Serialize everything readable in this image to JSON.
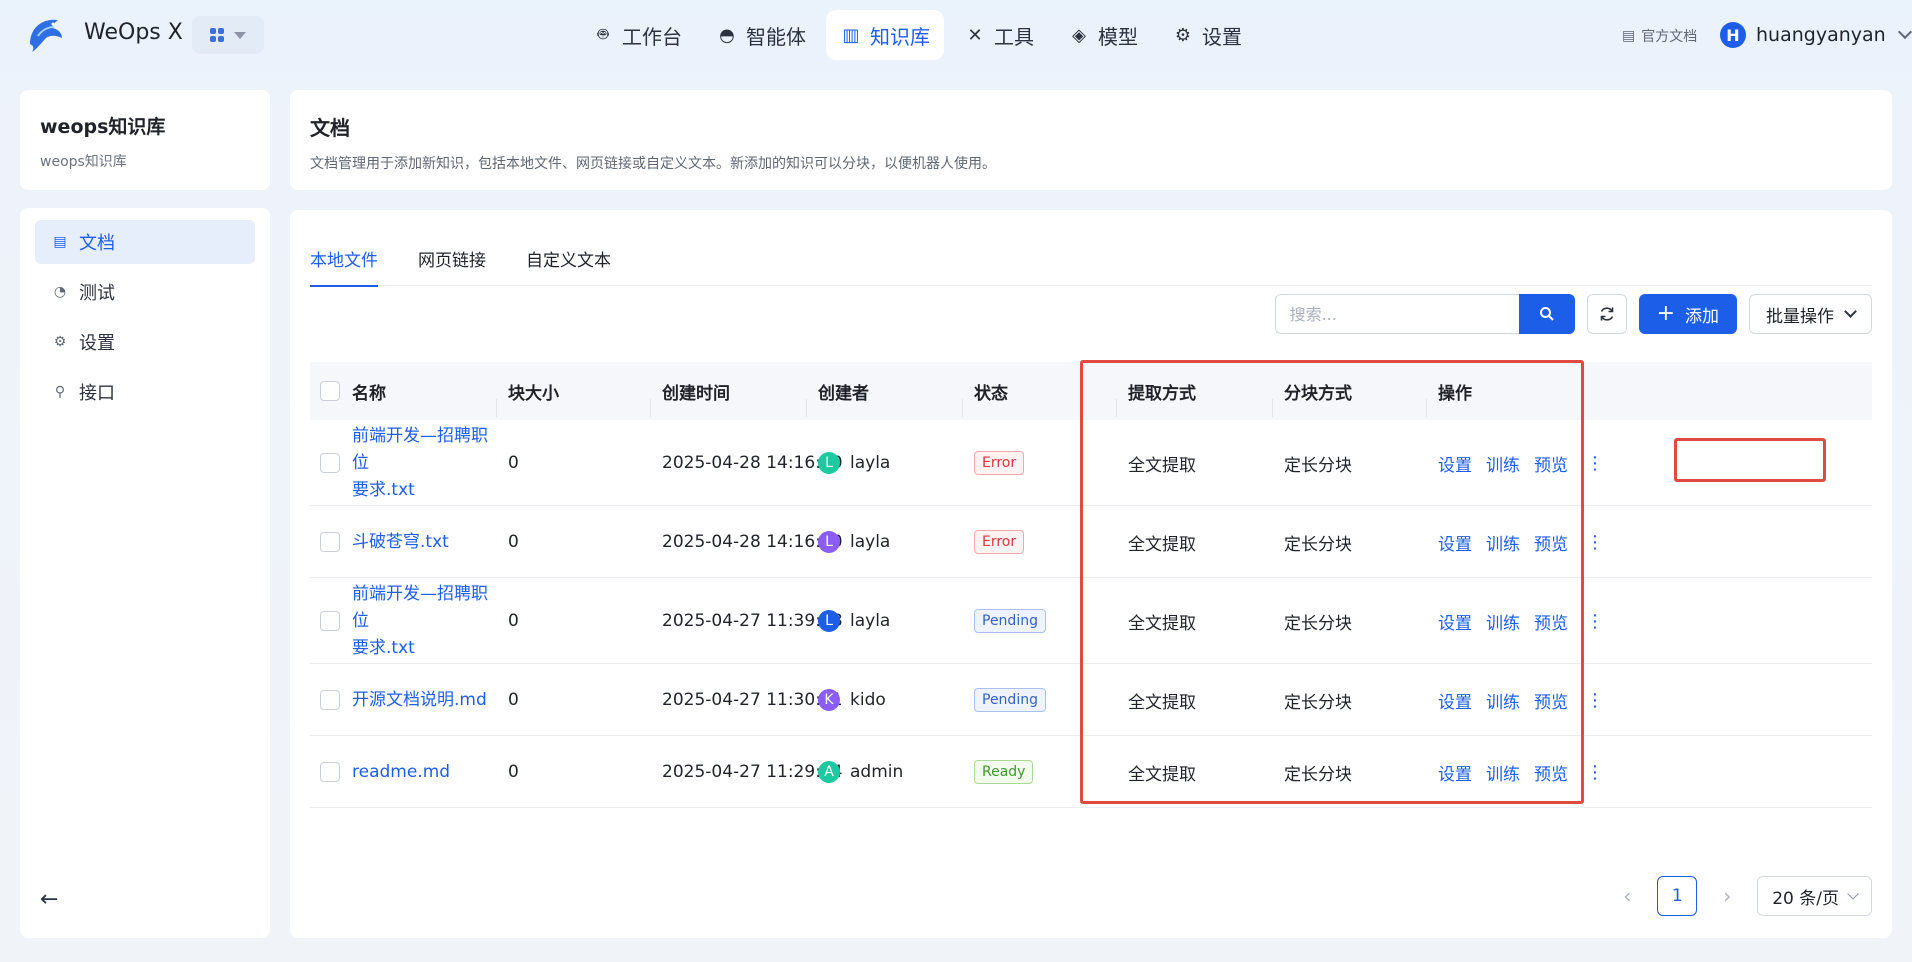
{
  "app": {
    "name": "WeOps X",
    "logo_icon": "dolphin-logo-icon"
  },
  "nav": [
    {
      "label": "工作台",
      "icon": "robot-icon",
      "active": false
    },
    {
      "label": "智能体",
      "icon": "agent-icon",
      "active": false
    },
    {
      "label": "知识库",
      "icon": "books-icon",
      "active": true
    },
    {
      "label": "工具",
      "icon": "tools-icon",
      "active": false
    },
    {
      "label": "模型",
      "icon": "cube-icon",
      "active": false
    },
    {
      "label": "设置",
      "icon": "gear-icon",
      "active": false
    }
  ],
  "header": {
    "doc_link": "官方文档",
    "user_initial": "H",
    "user_name": "huangyanyan"
  },
  "kb": {
    "title": "weops知识库",
    "subtitle": "weops知识库"
  },
  "sidebar": {
    "items": [
      {
        "label": "文档",
        "icon": "document-icon",
        "active": true
      },
      {
        "label": "测试",
        "icon": "gauge-icon",
        "active": false
      },
      {
        "label": "设置",
        "icon": "gear-icon",
        "active": false
      },
      {
        "label": "接口",
        "icon": "plug-icon",
        "active": false
      }
    ]
  },
  "page": {
    "title": "文档",
    "description": "文档管理用于添加新知识，包括本地文件、网页链接或自定义文本。新添加的知识可以分块，以便机器人使用。"
  },
  "tabs": [
    {
      "label": "本地文件",
      "active": true
    },
    {
      "label": "网页链接",
      "active": false
    },
    {
      "label": "自定义文本",
      "active": false
    }
  ],
  "toolbar": {
    "search_placeholder": "搜索...",
    "add_label": "添加",
    "batch_label": "批量操作"
  },
  "table": {
    "headers": {
      "name": "名称",
      "chunk_size": "块大小",
      "created_at": "创建时间",
      "creator": "创建者",
      "status": "状态",
      "extract": "提取方式",
      "chunking": "分块方式",
      "actions": "操作"
    },
    "action_labels": {
      "settings": "设置",
      "train": "训练",
      "preview": "预览"
    },
    "rows": [
      {
        "name_line1": "前端开发—招聘职位",
        "name_line2": "要求.txt",
        "chunk_size": "0",
        "created_at": "2025-04-28 14:16:50",
        "creator_initial": "L",
        "creator": "layla",
        "avatar_color": "#1cc9a0",
        "status": "Error",
        "status_type": "error",
        "extract": "全文提取",
        "chunking": "定长分块"
      },
      {
        "name_line1": "斗破苍穹.txt",
        "name_line2": "",
        "chunk_size": "0",
        "created_at": "2025-04-28 14:16:50",
        "creator_initial": "L",
        "creator": "layla",
        "avatar_color": "#8b5cf6",
        "status": "Error",
        "status_type": "error",
        "extract": "全文提取",
        "chunking": "定长分块"
      },
      {
        "name_line1": "前端开发—招聘职位",
        "name_line2": "要求.txt",
        "chunk_size": "0",
        "created_at": "2025-04-27 11:39:58",
        "creator_initial": "L",
        "creator": "layla",
        "avatar_color": "#1d5ee8",
        "status": "Pending",
        "status_type": "pending",
        "extract": "全文提取",
        "chunking": "定长分块"
      },
      {
        "name_line1": "开源文档说明.md",
        "name_line2": "",
        "chunk_size": "0",
        "created_at": "2025-04-27 11:30:31",
        "creator_initial": "K",
        "creator": "kido",
        "avatar_color": "#8b5cf6",
        "status": "Pending",
        "status_type": "pending",
        "extract": "全文提取",
        "chunking": "定长分块"
      },
      {
        "name_line1": "readme.md",
        "name_line2": "",
        "chunk_size": "0",
        "created_at": "2025-04-27 11:29:34",
        "creator_initial": "A",
        "creator": "admin",
        "avatar_color": "#1cc9a0",
        "status": "Ready",
        "status_type": "ready",
        "extract": "全文提取",
        "chunking": "定长分块"
      }
    ]
  },
  "pagination": {
    "current": "1",
    "page_size": "20 条/页"
  },
  "colors": {
    "accent": "#1d5ee8",
    "highlight": "#e04a3f"
  }
}
